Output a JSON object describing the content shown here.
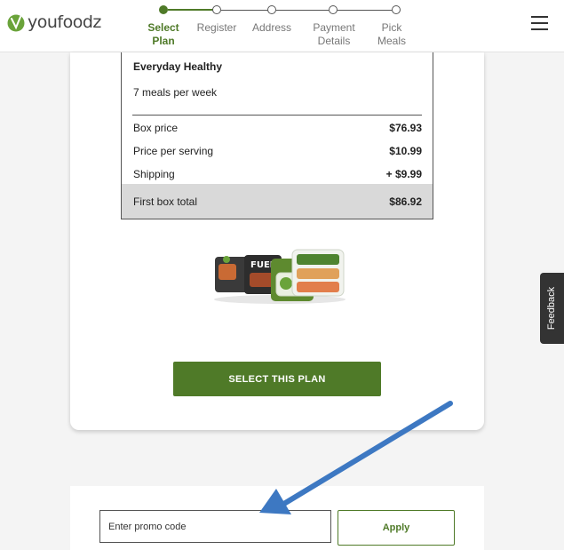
{
  "header": {
    "logo_text": "youfoodz",
    "steps": [
      {
        "line1": "Select",
        "line2": "Plan",
        "state": "active"
      },
      {
        "line1": "Register",
        "line2": "",
        "state": "pending"
      },
      {
        "line1": "Address",
        "line2": "",
        "state": "pending"
      },
      {
        "line1": "Payment",
        "line2": "Details",
        "state": "pending"
      },
      {
        "line1": "Pick",
        "line2": "Meals",
        "state": "pending"
      }
    ],
    "menu_icon": "hamburger-menu-icon"
  },
  "plan": {
    "name": "Everyday Healthy",
    "meals": "7 meals per week",
    "rows": [
      {
        "label": "Box price",
        "value": "$76.93"
      },
      {
        "label": "Price per serving",
        "value": "$10.99"
      },
      {
        "label": "Shipping",
        "value": "+ $9.99"
      }
    ],
    "total": {
      "label": "First box total",
      "value": "$86.92"
    },
    "select_button": "SELECT THIS PLAN"
  },
  "promo": {
    "placeholder": "Enter promo code",
    "apply_button": "Apply"
  },
  "feedback_label": "Feedback",
  "colors": {
    "brand_green": "#4f7a28",
    "annotation_arrow": "#3d78c2"
  }
}
